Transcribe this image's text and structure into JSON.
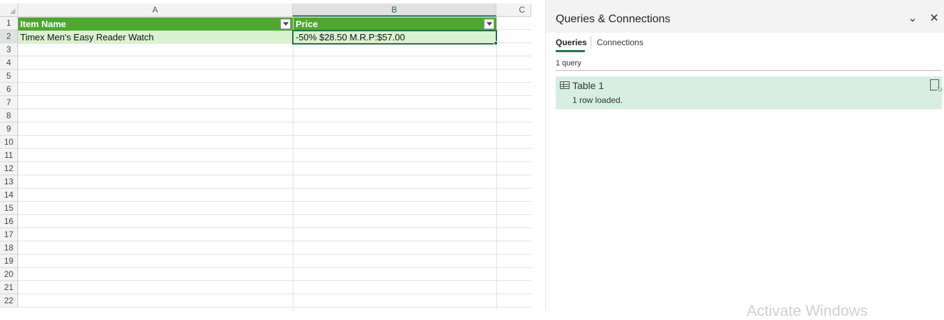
{
  "sheet": {
    "columns": [
      "A",
      "B",
      "C"
    ],
    "rows": [
      "1",
      "2",
      "3",
      "4",
      "5",
      "6",
      "7",
      "8",
      "9",
      "10",
      "11",
      "12",
      "13",
      "14",
      "15",
      "16",
      "17",
      "18",
      "19",
      "20",
      "21",
      "22"
    ],
    "table_headers": [
      "Item Name",
      "Price"
    ],
    "table_rows": [
      [
        "Timex Men's Easy Reader Watch",
        "-50% $28.50 M.R.P:$57.00"
      ]
    ]
  },
  "pane": {
    "title": "Queries & Connections",
    "tabs": [
      "Queries",
      "Connections"
    ],
    "count": "1 query",
    "query_name": "Table 1",
    "query_status": "1 row loaded."
  },
  "watermark": "Activate Windows",
  "colors": {
    "table_header": "#4ea72e",
    "table_band": "#d9f2d0",
    "selection": "#217346",
    "query_highlight": "#d6efe1"
  }
}
